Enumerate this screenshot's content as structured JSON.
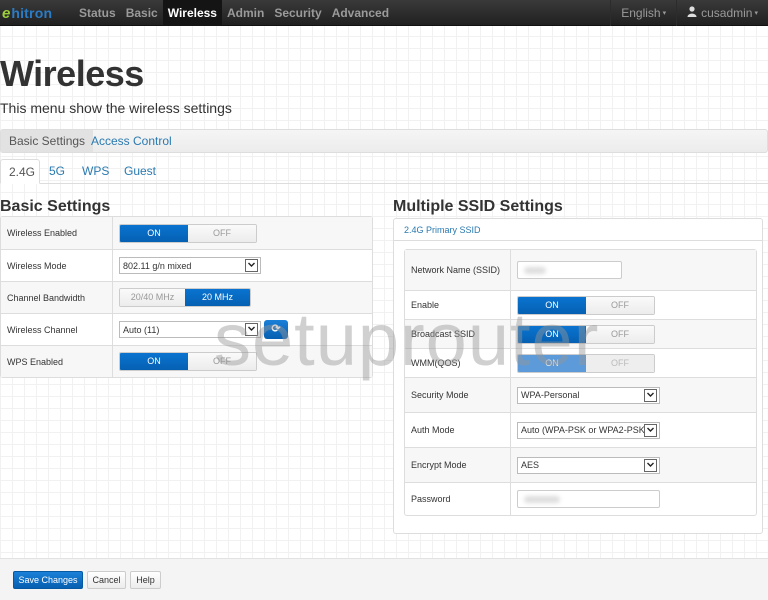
{
  "navbar": {
    "logo_mark": "e",
    "logo_text": "hitron",
    "items": [
      "Status",
      "Basic",
      "Wireless",
      "Admin",
      "Security",
      "Advanced"
    ],
    "active": "Wireless",
    "language": "English",
    "user": "cusadmin",
    "user_icon": "user-icon",
    "caret_glyph": "▾"
  },
  "header": {
    "title": "Wireless",
    "subtitle": "This menu show the wireless settings"
  },
  "top_tabs": [
    {
      "label": "Basic Settings",
      "active": true
    },
    {
      "label": "Access Control",
      "active": false
    }
  ],
  "band_tabs": [
    {
      "label": "2.4G",
      "active": true
    },
    {
      "label": "5G",
      "active": false
    },
    {
      "label": "WPS",
      "active": false
    },
    {
      "label": "Guest",
      "active": false
    }
  ],
  "basic_settings": {
    "title": "Basic Settings",
    "wireless_enabled": {
      "label": "Wireless Enabled",
      "on": "ON",
      "off": "OFF",
      "value": "ON"
    },
    "wireless_mode": {
      "label": "Wireless Mode",
      "value": "802.11 g/n mixed"
    },
    "channel_bandwidth": {
      "label": "Channel Bandwidth",
      "options": [
        "20/40 MHz",
        "20 MHz"
      ],
      "value": "20 MHz"
    },
    "wireless_channel": {
      "label": "Wireless Channel",
      "value": "Auto (11)",
      "refresh_icon": "refresh-icon"
    },
    "wps_enabled": {
      "label": "WPS Enabled",
      "on": "ON",
      "off": "OFF",
      "value": "ON"
    }
  },
  "ssid_settings": {
    "title": "Multiple SSID Settings",
    "panel_head": "2.4G Primary SSID",
    "network_name": {
      "label": "Network Name (SSID)",
      "value": "[blurred]"
    },
    "enable": {
      "label": "Enable",
      "on": "ON",
      "off": "OFF",
      "value": "ON"
    },
    "broadcast_ssid": {
      "label": "Broadcast SSID",
      "on": "ON",
      "off": "OFF",
      "value": "ON"
    },
    "wmm_qos": {
      "label": "WMM(QOS)",
      "on": "ON",
      "off": "OFF",
      "value": "ON",
      "disabled": true
    },
    "security_mode": {
      "label": "Security Mode",
      "value": "WPA-Personal"
    },
    "auth_mode": {
      "label": "Auth Mode",
      "value": "Auto (WPA-PSK or WPA2-PSK)"
    },
    "encrypt_mode": {
      "label": "Encrypt Mode",
      "value": "AES"
    },
    "password": {
      "label": "Password",
      "value": "[blurred]"
    }
  },
  "footer": {
    "save": "Save Changes",
    "cancel": "Cancel",
    "help": "Help"
  },
  "watermark": "setuprouter",
  "glyphs": {
    "select_arrow": "⌄",
    "refresh": "⟳"
  }
}
